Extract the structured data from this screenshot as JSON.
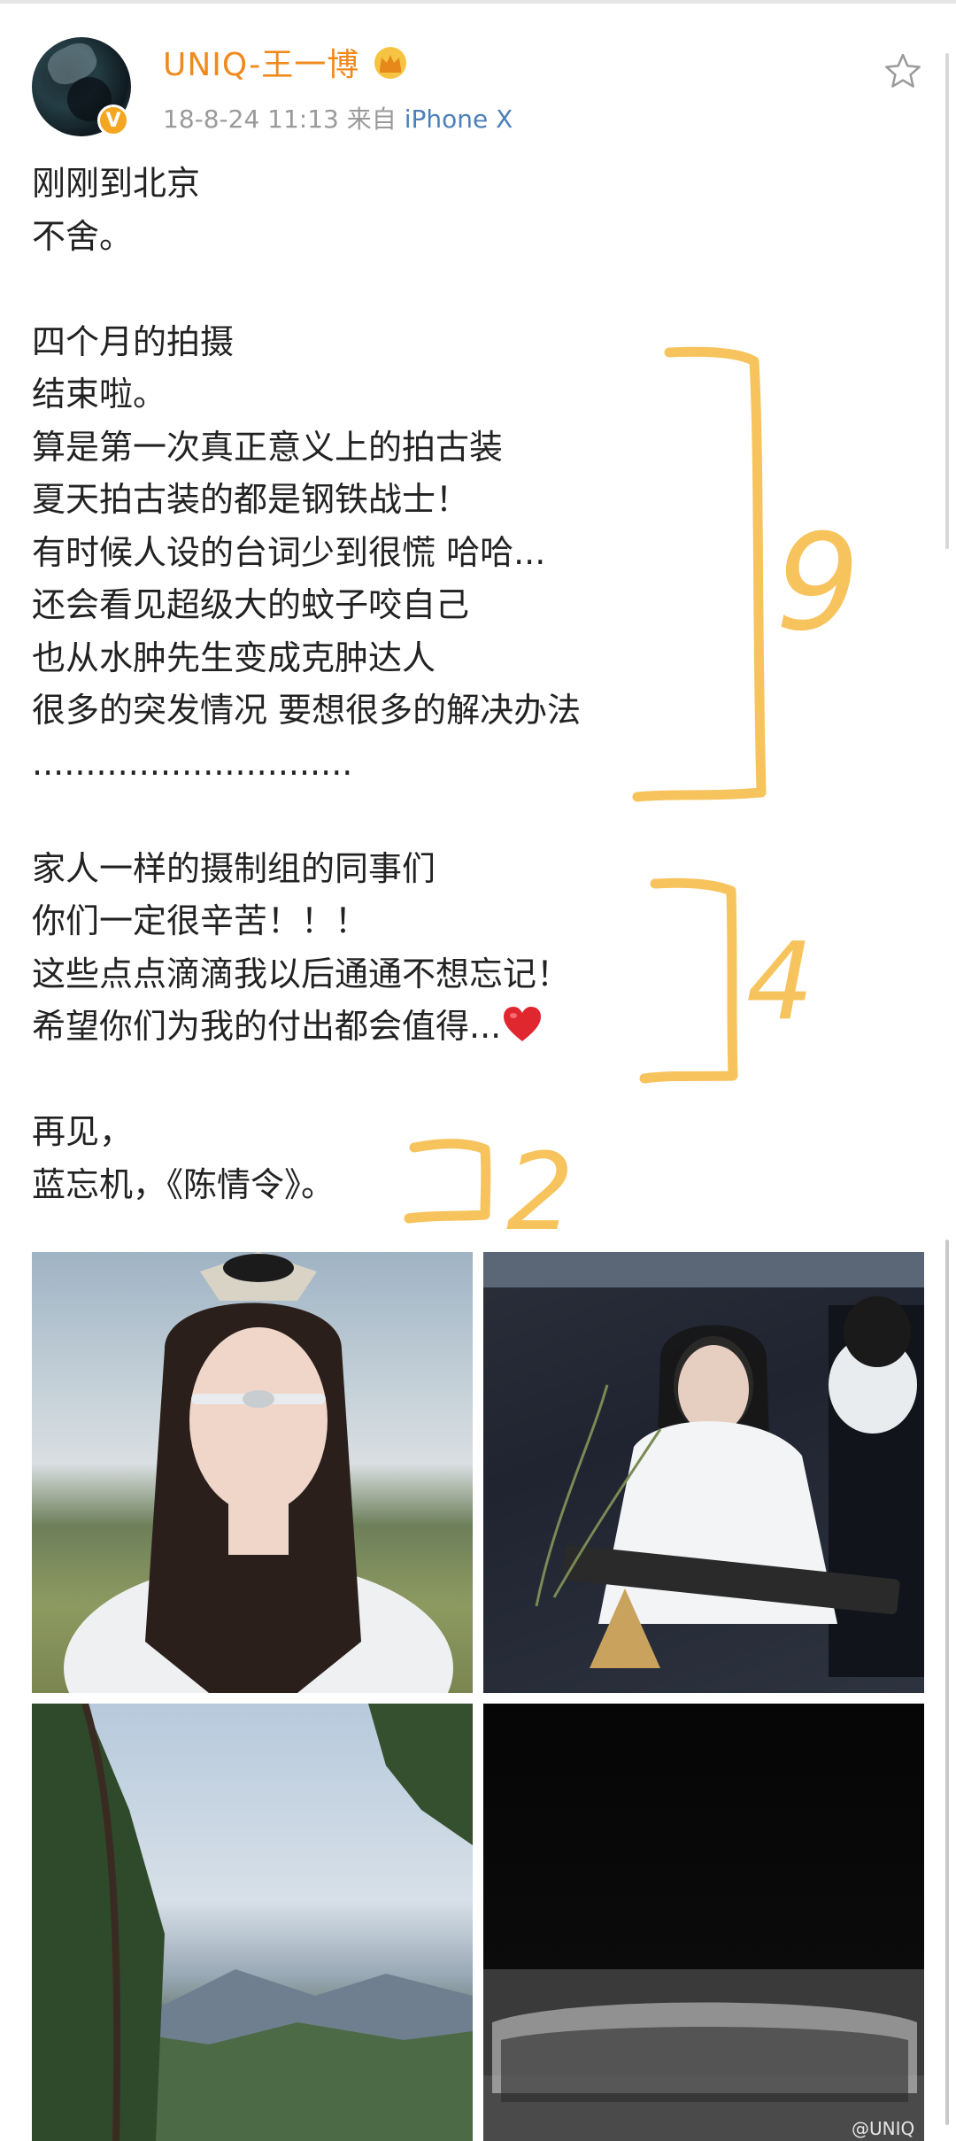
{
  "post": {
    "username": "UNIQ-王一博",
    "timestamp": "18-8-24 11:13",
    "source_prefix": "来自",
    "device": "iPhone X",
    "lines": [
      "刚刚到北京",
      "不舍。",
      "",
      "四个月的拍摄",
      "结束啦。",
      "算是第一次真正意义上的拍古装",
      "夏天拍古装的都是钢铁战士！",
      "有时候人设的台词少到很慌 哈哈...",
      "还会看见超级大的蚊子咬自己",
      "也从水肿先生变成克肿达人",
      "很多的突发情况 要想很多的解决办法",
      "..............................",
      "",
      "家人一样的摄制组的同事们",
      "你们一定很辛苦！！！",
      "这些点点滴滴我以后通通不想忘记！",
      "希望你们为我的付出都会值得...",
      "",
      "再见，",
      "蓝忘机，《陈情令》。"
    ],
    "heart_emoji": "red-heart-icon"
  },
  "annotations": {
    "color": "#f7c35c",
    "labels": [
      "9",
      "4",
      "2"
    ]
  },
  "photos": [
    {
      "name": "selfie-in-costume"
    },
    {
      "name": "playing-guqin-scene"
    },
    {
      "name": "mountain-landscape"
    },
    {
      "name": "crew-group-photo"
    }
  ],
  "watermark": "@UNIQ",
  "icons": {
    "verified": "v-badge-icon",
    "crown": "crown-icon",
    "favorite": "star-icon"
  },
  "colors": {
    "username": "#f08a1c",
    "device_link": "#4d7fb8",
    "meta": "#9a9a9a",
    "text": "#222222"
  }
}
